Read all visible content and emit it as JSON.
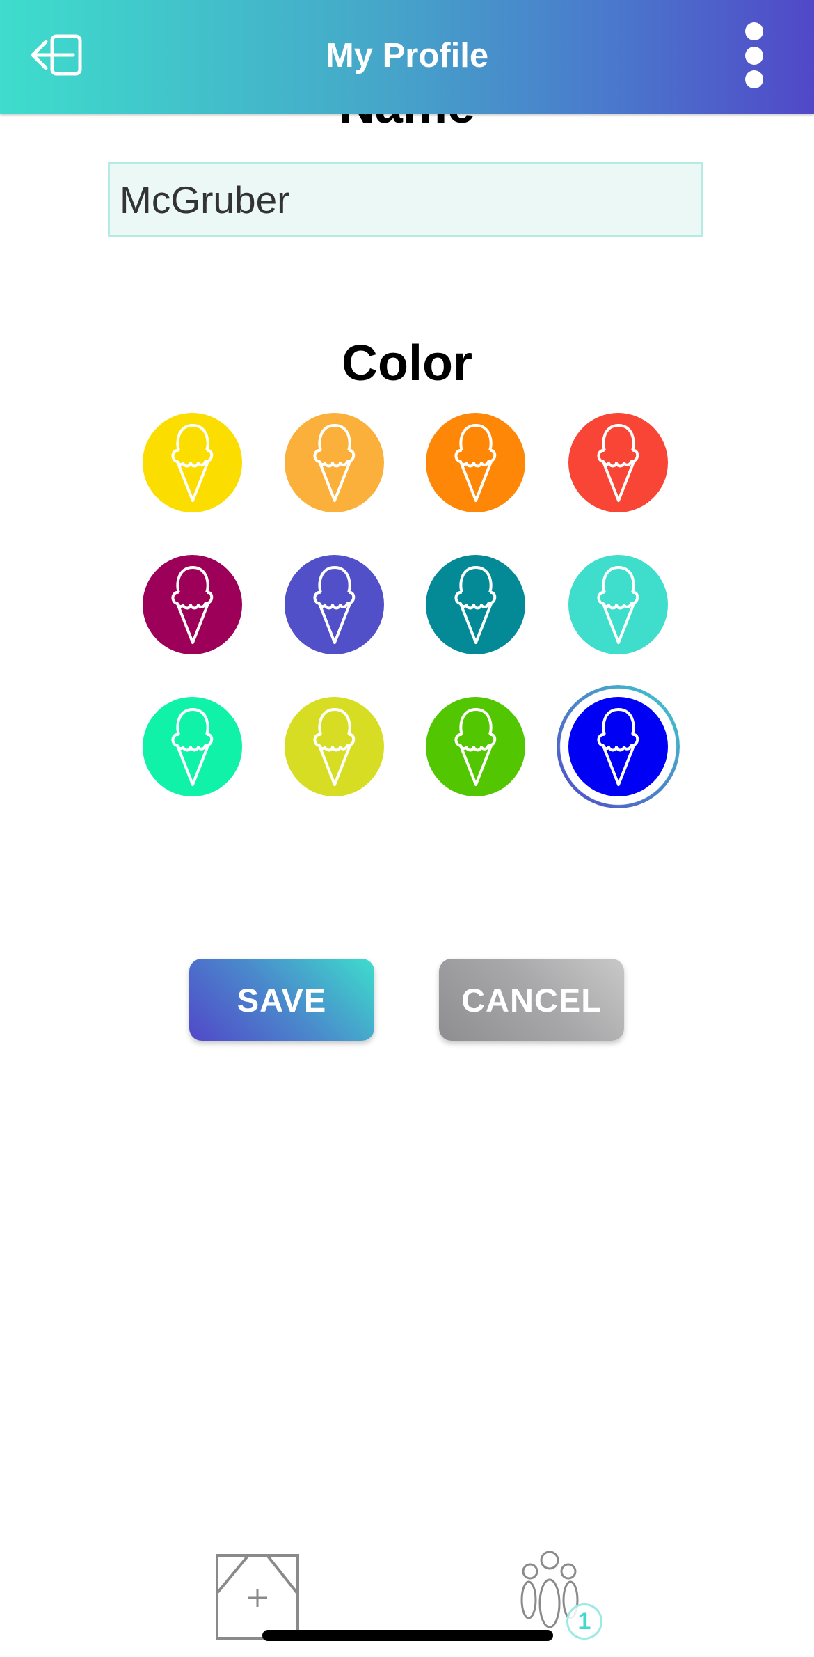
{
  "header": {
    "title": "My Profile",
    "left_icon": "logout-icon",
    "right_icon": "more-vertical-icon",
    "gradient": [
      "#3EDDCC",
      "#5148C8"
    ]
  },
  "name_section": {
    "heading": "Name",
    "input_value": "McGruber"
  },
  "color_section": {
    "heading": "Color",
    "icon": "ice-cream-icon",
    "swatches": [
      {
        "name": "yellow",
        "color": "#FBDD00",
        "selected": false
      },
      {
        "name": "light-orange",
        "color": "#FBB03B",
        "selected": false
      },
      {
        "name": "orange",
        "color": "#FF8708",
        "selected": false
      },
      {
        "name": "red",
        "color": "#F84536",
        "selected": false
      },
      {
        "name": "magenta",
        "color": "#9C0058",
        "selected": false
      },
      {
        "name": "indigo",
        "color": "#5150C8",
        "selected": false
      },
      {
        "name": "teal",
        "color": "#038A96",
        "selected": false
      },
      {
        "name": "turquoise",
        "color": "#3EDDCC",
        "selected": false
      },
      {
        "name": "spring-green",
        "color": "#0FF2A8",
        "selected": false
      },
      {
        "name": "lime",
        "color": "#D7DD22",
        "selected": false
      },
      {
        "name": "green",
        "color": "#52C600",
        "selected": false
      },
      {
        "name": "blue",
        "color": "#0000F5",
        "selected": true
      }
    ]
  },
  "actions": {
    "save_label": "SAVE",
    "cancel_label": "CANCEL"
  },
  "tab_bar": {
    "items": [
      {
        "name": "add-room",
        "icon": "add-room-icon"
      },
      {
        "name": "members",
        "icon": "people-icon",
        "badge": "1"
      }
    ]
  }
}
